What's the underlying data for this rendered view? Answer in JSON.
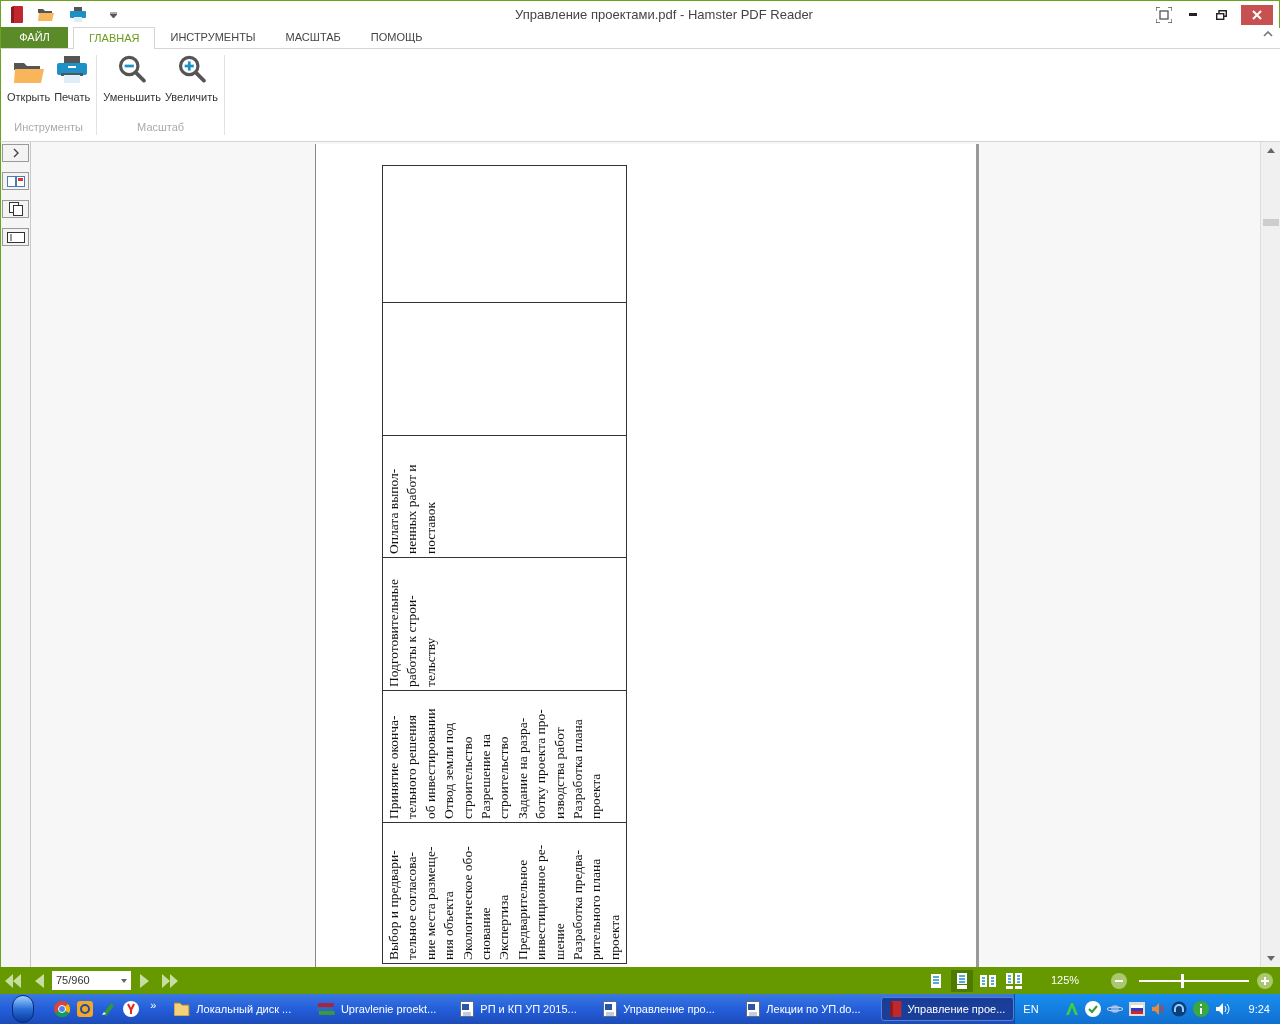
{
  "window": {
    "title": "Управление проектами.pdf - Hamster PDF Reader"
  },
  "menu_tabs": [
    {
      "label": "ФАЙЛ",
      "kind": "file",
      "selected": false
    },
    {
      "label": "ГЛАВНАЯ",
      "kind": "tab",
      "selected": true
    },
    {
      "label": "ИНСТРУМЕНТЫ",
      "kind": "tab",
      "selected": false
    },
    {
      "label": "МАСШТАБ",
      "kind": "tab",
      "selected": false
    },
    {
      "label": "ПОМОЩЬ",
      "kind": "tab",
      "selected": false
    }
  ],
  "ribbon_groups": [
    {
      "label": "Инструменты",
      "buttons": [
        {
          "label": "Открыть",
          "kind": "folder"
        },
        {
          "label": "Печать",
          "kind": "printer"
        }
      ]
    },
    {
      "label": "Масштаб",
      "buttons": [
        {
          "label": "Уменьшить",
          "kind": "zoom-out"
        },
        {
          "label": "Увеличить",
          "kind": "zoom-in"
        }
      ]
    }
  ],
  "document": {
    "table_rows": [
      {
        "kind": "empty"
      },
      {
        "kind": "empty"
      },
      {
        "kind": "text",
        "lines": [
          "Оплата выпол-",
          "ненных работ и",
          "поставок"
        ]
      },
      {
        "kind": "text",
        "lines": [
          "Подготовительные",
          "работы к строи-",
          "тельству"
        ]
      },
      {
        "kind": "text",
        "lines": [
          "Принятие оконча-",
          "тельного решения",
          "об инвестировании",
          "Отвод земли под",
          "строительство",
          "Разрешение на",
          "строительство",
          "Задание на разра-",
          "ботку проекта про-",
          "изводства работ",
          "Разработка плана",
          "проекта"
        ]
      },
      {
        "kind": "text",
        "lines": [
          "Выбор и предвари-",
          "тельное согласова-",
          "ние места размеще-",
          "ния объекта",
          "Экологическое обо-",
          "снование",
          "Экспертиза",
          "Предварительное",
          "инвестиционное ре-",
          "шение",
          "Разработка предва-",
          "рительного плана",
          "проекта"
        ]
      }
    ]
  },
  "status_bar": {
    "page": "75/960",
    "views": [
      {
        "kind": "single",
        "selected": false
      },
      {
        "kind": "continuous",
        "selected": true
      },
      {
        "kind": "facing",
        "selected": false
      },
      {
        "kind": "facing-continuous",
        "selected": false
      }
    ],
    "zoom": "125%",
    "zoom_slider": {
      "level": 0.39
    }
  },
  "taskbar": {
    "more": "»",
    "tasks": [
      {
        "label": "Локальный диск ...",
        "kind": "folder",
        "selected": false
      },
      {
        "label": "Upravlenie proekt...",
        "kind": "archive",
        "selected": false
      },
      {
        "label": "РП и КП  УП 2015...",
        "kind": "document",
        "selected": false
      },
      {
        "label": "Управление про...",
        "kind": "document",
        "selected": false
      },
      {
        "label": "Лекции по УП.do...",
        "kind": "document",
        "selected": false
      },
      {
        "label": "Управление прое...",
        "kind": "book",
        "selected": true
      }
    ],
    "language": "EN",
    "clock": "9:24"
  }
}
